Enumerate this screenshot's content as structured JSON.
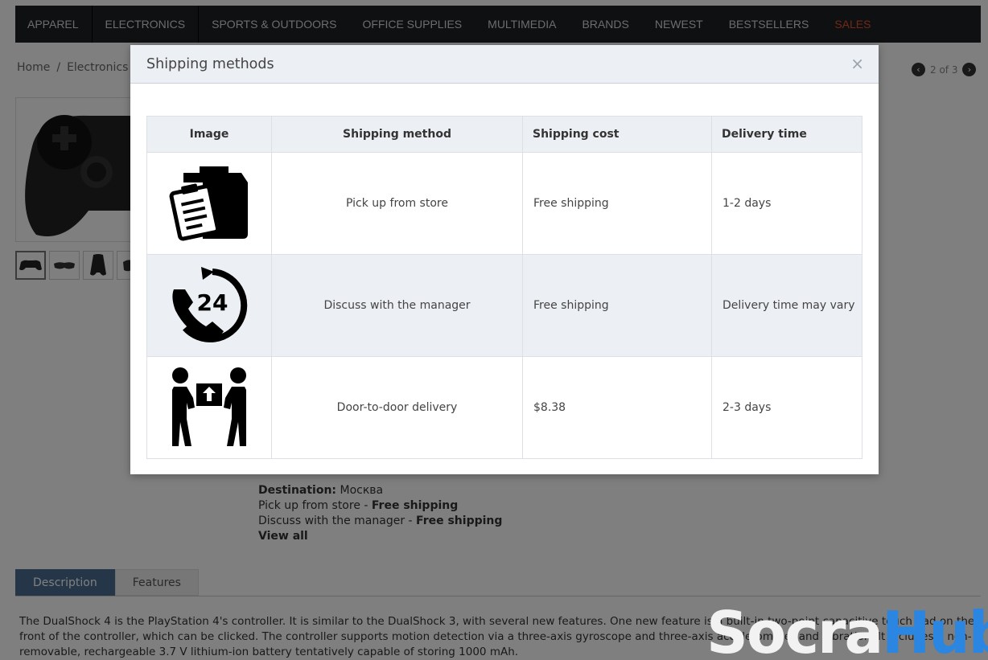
{
  "nav": {
    "items": [
      "APPAREL",
      "ELECTRONICS",
      "SPORTS & OUTDOORS",
      "OFFICE SUPPLIES",
      "MULTIMEDIA",
      "BRANDS",
      "NEWEST",
      "BESTSELLERS"
    ],
    "sales": "SALES",
    "sales_color": "#e4512b"
  },
  "breadcrumb": {
    "home": "Home",
    "sep": "/",
    "category": "Electronics"
  },
  "pager": {
    "prev": "‹",
    "label": "2 of 3",
    "next": "›"
  },
  "shipping_info": {
    "destination_label": "Destination:",
    "destination_value": "Москва",
    "line1_method": "Pick up from store",
    "line1_dash": " - ",
    "line1_cost": "Free shipping",
    "line2_method": "Discuss with the manager",
    "line2_dash": " - ",
    "line2_cost": "Free shipping",
    "view_all": "View all"
  },
  "tabs": {
    "description": "Description",
    "features": "Features",
    "accent_color": "#4a6d93"
  },
  "description": "The DualShock 4 is the PlayStation 4's controller. It is similar to the DualShock 3, with several new features. One new feature is a built-in two-point capacitive touch pad on the front of the controller, which can be clicked. The controller supports motion detection via a three-axis gyroscope and three-axis accelerometer and vibration. It includes a non-removable, rechargeable 3.7 V lithium-ion battery tentatively capable of storing 1000 mAh.",
  "watermark": {
    "part1": "Socra",
    "part2": "Hub"
  },
  "modal": {
    "title": "Shipping methods",
    "close": "×",
    "columns": {
      "image": "Image",
      "method": "Shipping method",
      "cost": "Shipping cost",
      "time": "Delivery time"
    },
    "rows": [
      {
        "icon": "package-clipboard-icon",
        "method": "Pick up from store",
        "cost": "Free shipping",
        "time": "1-2 days"
      },
      {
        "icon": "phone-24-icon",
        "method": "Discuss with the manager",
        "cost": "Free shipping",
        "time": "Delivery time may vary"
      },
      {
        "icon": "door-to-door-delivery-icon",
        "method": "Door-to-door delivery",
        "cost": "$8.38",
        "time": "2-3 days"
      }
    ],
    "phone_icon_text": "24"
  }
}
